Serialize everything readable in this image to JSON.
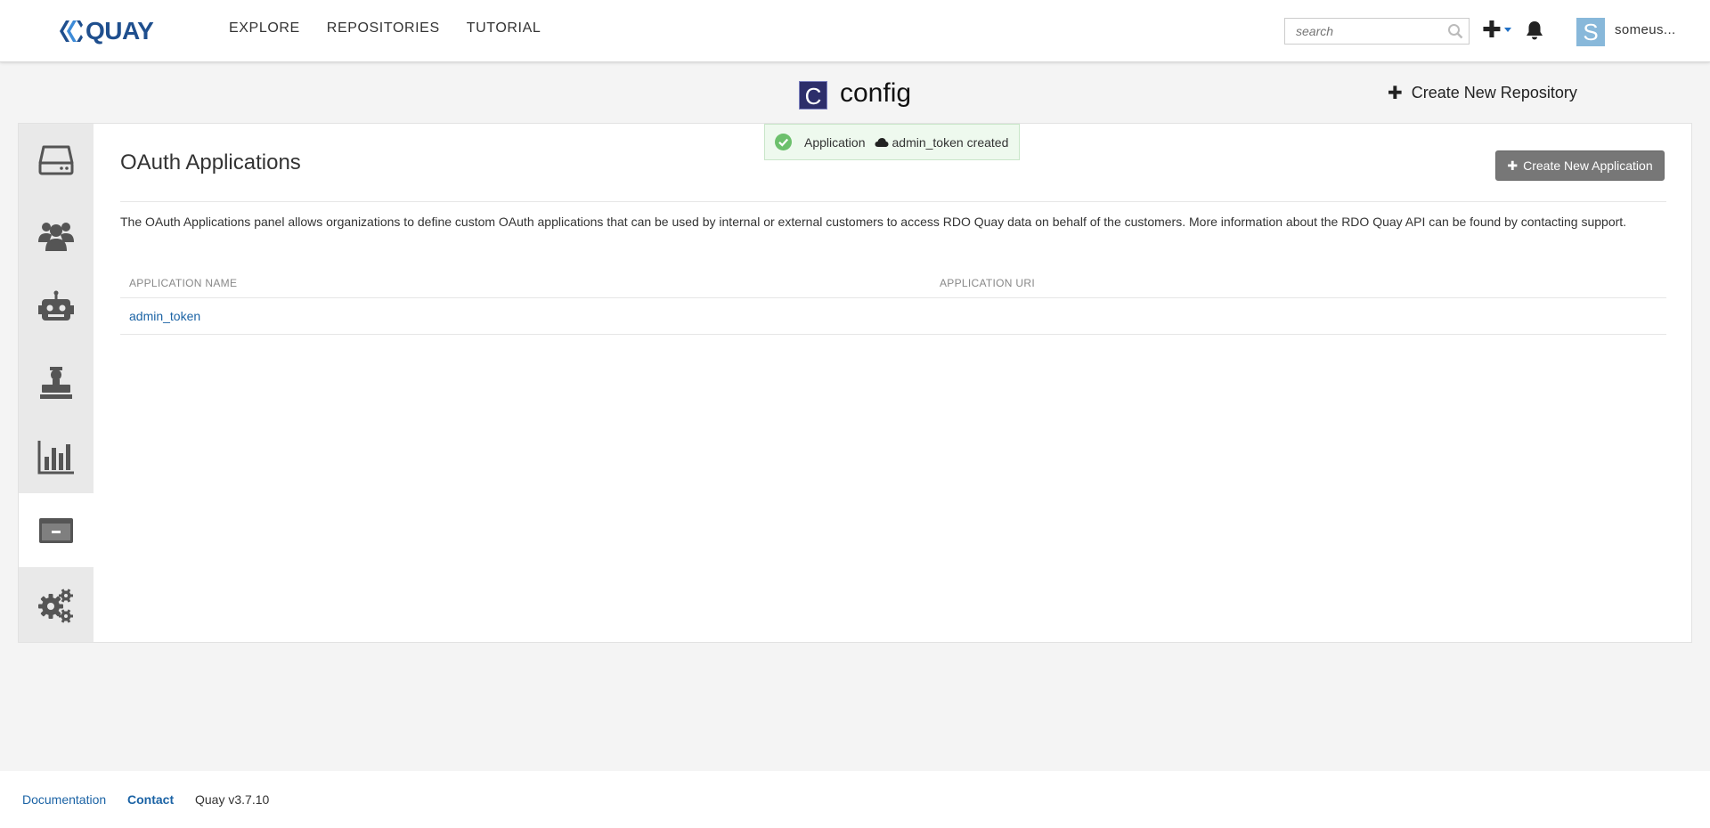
{
  "brand": {
    "name": "QUAY"
  },
  "nav": {
    "explore": "EXPLORE",
    "repositories": "REPOSITORIES",
    "tutorial": "TUTORIAL"
  },
  "search": {
    "placeholder": "search"
  },
  "user": {
    "avatar_letter": "S",
    "name": "someus..."
  },
  "org": {
    "badge_letter": "C",
    "name": "config",
    "badge_color": "#2d2e6a"
  },
  "create_repo": {
    "label": "Create New Repository"
  },
  "toast": {
    "prefix": "Application",
    "app_name": "admin_token",
    "suffix": "created"
  },
  "sidebar": {
    "items": [
      {
        "icon": "hdd-icon"
      },
      {
        "icon": "users-icon"
      },
      {
        "icon": "robot-icon"
      },
      {
        "icon": "default-permissions-icon"
      },
      {
        "icon": "usage-chart-icon"
      },
      {
        "icon": "oauth-applications-icon",
        "active": true
      },
      {
        "icon": "settings-gears-icon"
      }
    ]
  },
  "main": {
    "title": "OAuth Applications",
    "create_app_label": "Create New Application",
    "description": "The OAuth Applications panel allows organizations to define custom OAuth applications that can be used by internal or external customers to access RDO Quay data on behalf of the customers. More information about the RDO Quay API can be found by contacting support.",
    "table": {
      "columns": [
        "APPLICATION NAME",
        "APPLICATION URI"
      ],
      "rows": [
        {
          "name": "admin_token",
          "uri": ""
        }
      ]
    }
  },
  "footer": {
    "documentation": "Documentation",
    "contact": "Contact",
    "version": "Quay v3.7.10"
  },
  "colors": {
    "link": "#1b63a5",
    "brand": "#1f4f8e",
    "button": "#777777"
  }
}
